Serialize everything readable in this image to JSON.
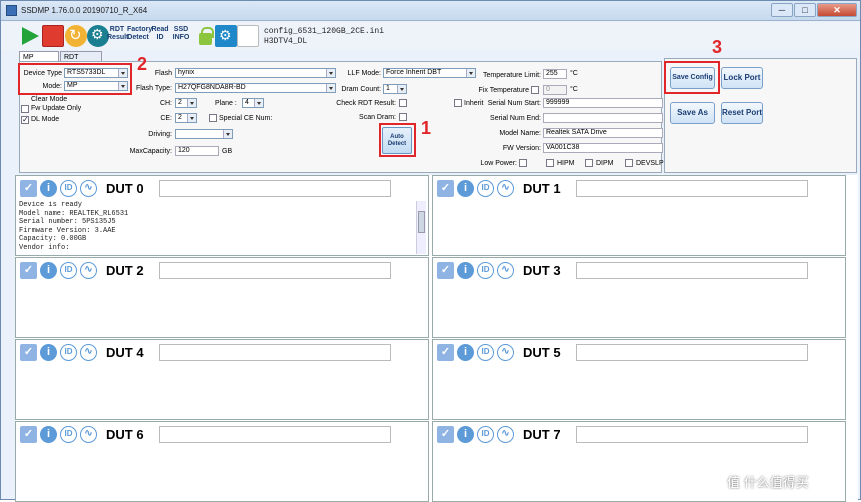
{
  "window": {
    "title": "SSDMP 1.76.0.0 20190710_R_X64",
    "minimize": "─",
    "maximize": "□",
    "close": "✕"
  },
  "toolbar": {
    "rdt_result": "RDT Result",
    "factory_detect": "Factory Detect",
    "read_id": "Read ID",
    "ssd_info": "SSD INFO",
    "config_file": "config_6531_120GB_2CE.ini",
    "config_sub": "H3DTV4_DL"
  },
  "tabs": [
    "MP Setting",
    "RDT Setting"
  ],
  "mp": {
    "device_type_label": "Device Type",
    "device_type_value": "RTS5733DL",
    "mode_label": "Mode:",
    "mode_value": "MP",
    "clear_mode": "Clear Mode",
    "fw_update_only": "Fw Update Only",
    "dl_mode": "DL Mode",
    "flash_label": "Flash",
    "flash_value": "hynix",
    "flash_type_label": "Flash Type:",
    "flash_type_value": "H27QFG8NDA8R-BD",
    "ch_label": "CH:",
    "ch_value": "2",
    "plane_label": "Plane :",
    "plane_value": "4",
    "ce_label": "CE:",
    "ce_value": "2",
    "special_ce": "Special CE Num:",
    "driving_label": "Driving:",
    "driving_value": "",
    "maxcap_label": "MaxCapacity:",
    "maxcap_value": "120",
    "maxcap_unit": "GB",
    "llf_label": "LLF Mode:",
    "llf_value": "Force Inherit DBT",
    "dram_label": "Dram Count:",
    "dram_value": "1",
    "check_rdt": "Check RDT Result:",
    "scan_dram": "Scan Dram:",
    "auto_detect": "Auto Detect",
    "temp_limit_label": "Temperature Limit:",
    "temp_limit_value": "255",
    "temp_unit": "°C",
    "fix_temp_label": "Fix Temperature",
    "fix_temp_value": "0",
    "inherit_label": "Inherit",
    "serial_start_label": "Serial Num Start:",
    "serial_start_value": "999999",
    "serial_end_label": "Serial Num End:",
    "serial_end_value": "",
    "model_label": "Model Name:",
    "model_value": "Realtek SATA Drive",
    "fw_label": "FW Version:",
    "fw_value": "VA001C38",
    "low_power": "Low Power:",
    "hipm": "HIPM",
    "dipm": "DIPM",
    "devslp": "DEVSLP"
  },
  "right": {
    "save_config": "Save Config",
    "lock_port": "Lock Port",
    "save_as": "Save As",
    "reset_port": "Reset Port"
  },
  "annotations": [
    "1",
    "2",
    "3"
  ],
  "duts": [
    {
      "name": "DUT 0",
      "log": "Device is ready\nModel name: REALTEK_RL6531\nSerial number: 5PS135J5\nFirmware Version: 3.AAE\nCapacity: 0.00GB\nVendor info:"
    },
    {
      "name": "DUT 1",
      "log": ""
    },
    {
      "name": "DUT 2",
      "log": ""
    },
    {
      "name": "DUT 3",
      "log": ""
    },
    {
      "name": "DUT 4",
      "log": ""
    },
    {
      "name": "DUT 5",
      "log": ""
    },
    {
      "name": "DUT 6",
      "log": ""
    },
    {
      "name": "DUT 7",
      "log": ""
    }
  ],
  "watermark": "值 什么值得买",
  "icons": [
    "play-icon",
    "stop-icon",
    "refresh-icon",
    "settings-icon",
    "lock-icon",
    "gear-icon",
    "document-icon",
    "check-icon",
    "info-icon",
    "id-icon",
    "waveform-icon"
  ]
}
